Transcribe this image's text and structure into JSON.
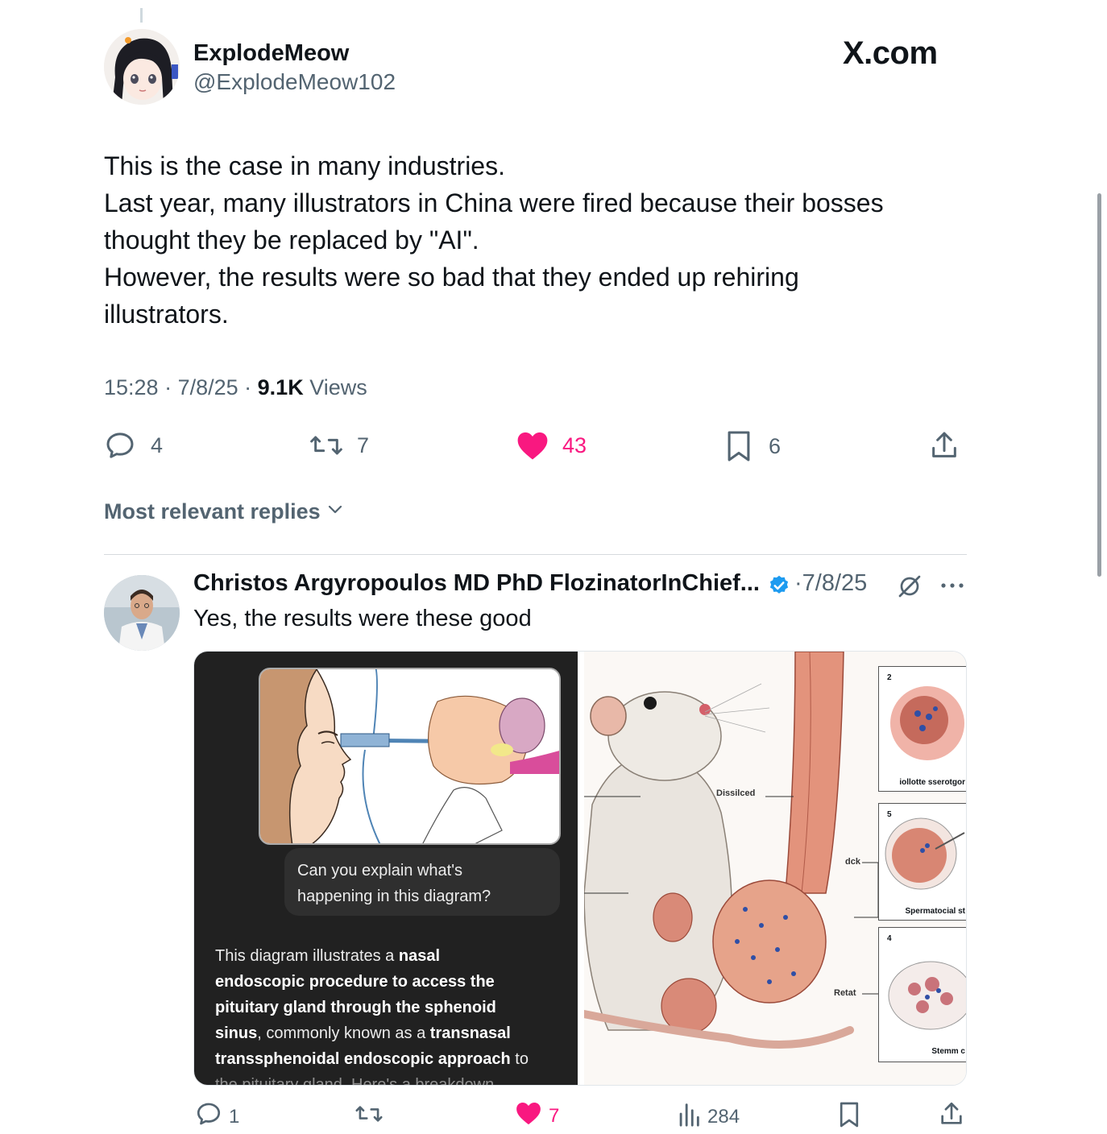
{
  "tweet": {
    "author_name": "ExplodeMeow",
    "author_handle": "@ExplodeMeow102",
    "brand": "X.com",
    "lines": [
      "This is the case in many industries.",
      "Last year, many illustrators in China were fired because their bosses",
      "thought they be replaced by \"AI\".",
      "However, the results were so bad that they ended up rehiring",
      "illustrators."
    ],
    "time": "15:28",
    "date": "7/8/25",
    "views_count": "9.1K",
    "views_label": "Views",
    "replies": "4",
    "reposts": "7",
    "likes": "43",
    "bookmarks": "6"
  },
  "sort": {
    "label": "Most relevant replies"
  },
  "reply": {
    "author_name": "Christos Argyropoulos MD PhD FlozinatorInChief...",
    "date": "7/8/25",
    "text": "Yes, the results were these good",
    "media": {
      "left": {
        "question_line1": "Can you explain what's",
        "question_line2": "happening in this diagram?",
        "answer": {
          "p1": "This diagram illustrates a ",
          "b1": "nasal",
          "b2": "endoscopic procedure to access the",
          "b3": "pituitary gland through the sphenoid",
          "b4": "sinus",
          "p2": ", commonly known as a ",
          "b5": "transnasal",
          "b6": "transsphenoidal endoscopic approach",
          "p3": " to",
          "p4": "the pituitary gland. Here's a breakdown"
        }
      },
      "right": {
        "labels": [
          "Dissilced",
          "dck",
          "Retat"
        ],
        "panels": [
          {
            "num": "2",
            "caption": "iollotte sserotgor"
          },
          {
            "num": "5",
            "caption": "Spermatocial st"
          },
          {
            "num": "4",
            "caption": "Stemm c"
          }
        ]
      }
    },
    "stats": {
      "replies": "1",
      "likes": "7",
      "views": "284"
    }
  },
  "colors": {
    "like": "#f91880",
    "verified": "#1d9bf0",
    "muted": "#536471",
    "text": "#0f1419"
  }
}
